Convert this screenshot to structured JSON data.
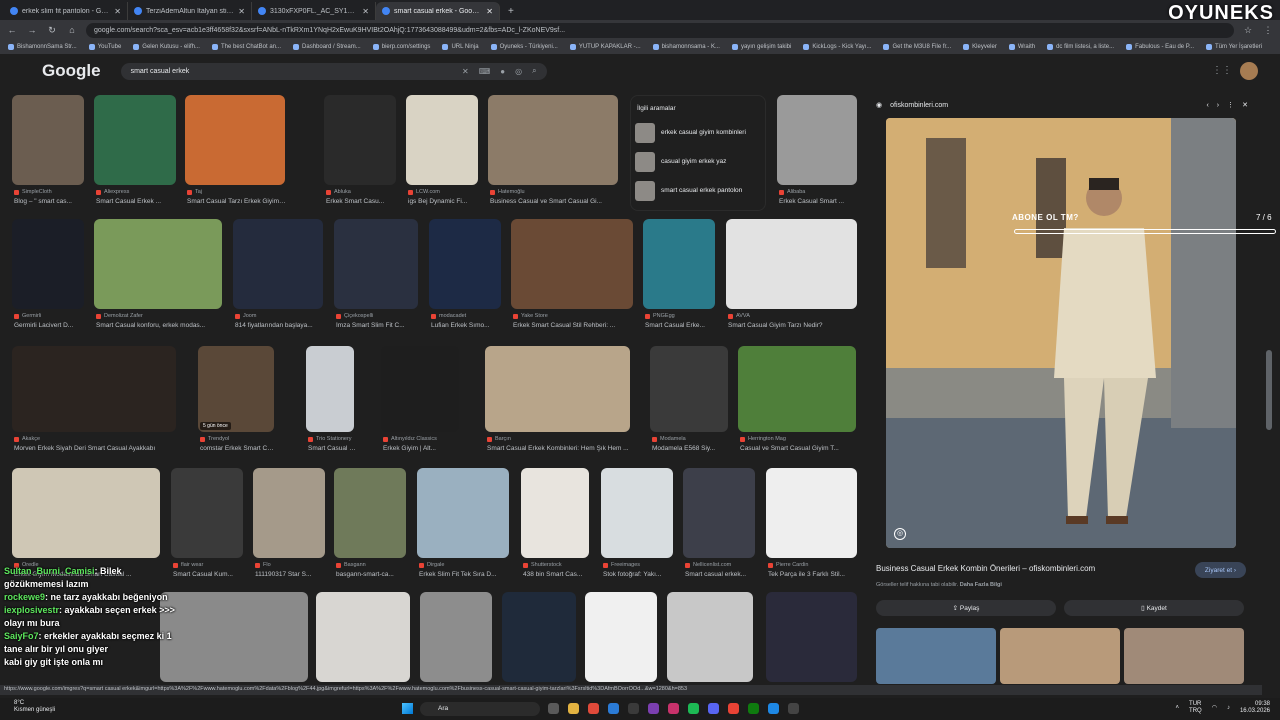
{
  "browser": {
    "tabs": [
      {
        "label": "erkek slim fit pantolon - Google'da A",
        "active": false
      },
      {
        "label": "TerziAdemAltun İtalyan stil slim fit er",
        "active": false
      },
      {
        "label": "3130xFXP0FL._AC_SY1000_.jpg (241×",
        "active": false
      },
      {
        "label": "smart casual erkek - Google'da Ara",
        "active": true
      }
    ],
    "new_tab": "+",
    "url": "google.com/search?sca_esv=acb1e3ff4658f32&sxsrf=ANbL-nTkRXm1YNqH2xEwuK9HVIBt2OAhjQ:1773643088499&udm=2&fbs=ADc_l-ZKoNEV9sf...",
    "bookmarks": [
      "BishamonnSama Str...",
      "YouTube",
      "Gelen Kutusu - elifh...",
      "The best ChatBot an...",
      "Dashboard / Stream...",
      "bierp.com/settings",
      "URL Ninja",
      "Oyuneks - Türkiyeni...",
      "YUTUP KAPAKLAR -...",
      "bishamonnsama - K...",
      "yayın gelişim takibi",
      "KickLogs - Kick Yayı...",
      "Get the M3U8 File fr...",
      "Kleyveler",
      "Wraith",
      "dc film listesi, a liste...",
      "Fabulous - Eau de P...",
      "Tüm Yer İşaretleri"
    ]
  },
  "brand_overlay": "OYUNEKS",
  "google": {
    "logo": "Google",
    "query": "smart casual erkek"
  },
  "related": {
    "header": "İlgili aramalar",
    "items": [
      "erkek casual giyim kombinleri",
      "casual giyim erkek yaz",
      "smart casual erkek pantolon"
    ]
  },
  "results": [
    {
      "src": "SimpleCloth",
      "title": "Blog – \" smart cas...",
      "color": "#6b5d50"
    },
    {
      "src": "Aliexpress",
      "title": "Smart Casual Erkek ...",
      "color": "#2f6b49"
    },
    {
      "src": "Taj",
      "title": "Smart Casual Tarzı Erkek Giyim Ko...",
      "color": "#c96a33"
    },
    {
      "src": "Abluka",
      "title": "Erkek Smart Casu...",
      "color": "#2a2a2a"
    },
    {
      "src": "LCW.com",
      "title": "igs Bej Dynamic Fi...",
      "color": "#d9d3c4"
    },
    {
      "src": "Hatemoğlu",
      "title": "Business Casual ve Smart Casual Gi...",
      "color": "#8c7b68"
    },
    {
      "src": "Alibaba",
      "title": "Erkek Casual Smart ...",
      "color": "#9a9a9a"
    },
    {
      "src": "Germirli",
      "title": "Germirli Lacivert D...",
      "color": "#1b1e27"
    },
    {
      "src": "Demolizat Zafer",
      "title": "Smart Casual konforu, erkek modas...",
      "color": "#7a9a5a"
    },
    {
      "src": "Joom",
      "title": "814 fiyatlarından başlaya...",
      "color": "#242b3d"
    },
    {
      "src": "Çiçekospelli",
      "title": "İmza Smart Slim Fit C...",
      "color": "#2a3040"
    },
    {
      "src": "modacadet",
      "title": "Lufian Erkek Sımo...",
      "color": "#1d2a45"
    },
    {
      "src": "Yake Store",
      "title": "Erkek Smart Casual Stil Rehberi: ...",
      "color": "#6a4a35"
    },
    {
      "src": "PNGEgg",
      "title": "Smart Casual Erke...",
      "color": "#2a7a8a"
    },
    {
      "src": "AVVA",
      "title": "Smart Casual Giyim Tarzı Nedir?",
      "color": "#e2e2e2"
    },
    {
      "src": "Akakçe",
      "title": "Morven Erkek Siyah Deri Smart Casual Ayakkabı",
      "color": "#2b2420"
    },
    {
      "src": "Trendyol",
      "title": "comstar Erkek Smart Ca...",
      "color": "#5a4838"
    },
    {
      "src": "Trio Stationery",
      "title": "Smart Casual Styl...",
      "color": "#c9cdd2"
    },
    {
      "src": "Altınyıldız Classics",
      "title": "Erkek Giyim | Alt...",
      "color": "#1e1e1e"
    },
    {
      "src": "Barçın",
      "title": "Smart Casual Erkek Kombinleri: Hem Şık Hem ...",
      "color": "#b8a58a"
    },
    {
      "src": "Modamela",
      "title": "Modamela E568 Siy...",
      "color": "#3a3a3a"
    },
    {
      "src": "Herrington Mag",
      "title": "Casual ve Smart Casual Giyim T...",
      "color": "#4f7f3a"
    },
    {
      "src": "Oredle",
      "title": "Erkek Giyim Modasında Smart Casual ...",
      "color": "#cfc7b5"
    },
    {
      "src": "flair wear",
      "title": "Smart Casual Kum...",
      "color": "#3a3a3a"
    },
    {
      "src": "Flo",
      "title": "111190317 Star S...",
      "color": "#a59a8a"
    },
    {
      "src": "Basgann",
      "title": "basgann-smart-ca...",
      "color": "#6f7a5a"
    },
    {
      "src": "Dirgale",
      "title": "Erkek Slim Fit Tek Sıra D...",
      "color": "#9ab0c0"
    },
    {
      "src": "Shutterstock",
      "title": "438 bin Smart Cas...",
      "color": "#e8e4de"
    },
    {
      "src": "Freeimages",
      "title": "Stok fotoğraf: Yakı...",
      "color": "#d8dde0"
    },
    {
      "src": "Nellicenlist.com",
      "title": "Smart casual erkek...",
      "color": "#3d3f4a"
    },
    {
      "src": "Pierre Cardin",
      "title": "Tek Parça ile 3 Farklı Stil...",
      "color": "#eeeeee"
    }
  ],
  "row5_colors": [
    "#8a8a8a",
    "#d8d6d2",
    "#8d8d8d",
    "#1f2a3a",
    "#f0f0f0",
    "#c8c8c8",
    "#2a2a3a"
  ],
  "thumb_badge": "5 gün önce",
  "panel": {
    "source": "ofiskombinleri.com",
    "title": "Business Casual Erkek Kombin Önerileri – ofiskombinleri.com",
    "subtitle": "Görseller telif hakkına tabi olabilir.",
    "subtitle_link": "Daha Fazla Bilgi",
    "visit": "Ziyaret et",
    "share": "Paylaş",
    "save": "Kaydet",
    "thumb_colors": [
      "#5a7a9a",
      "#b89a7a",
      "#a08a78"
    ]
  },
  "subscribe_overlay": {
    "text": "ABONE OL TM?",
    "count": "7 / 6"
  },
  "chat": [
    {
      "name": "Sultan_Burni_Camisi",
      "msg": ": Bilek"
    },
    {
      "name": "",
      "msg": "gözükmemesi lazım"
    },
    {
      "name": "rockewe9",
      "msg": ": ne tarz ayakkabı beğeniyon"
    },
    {
      "name": "iexplosivestr",
      "msg": ": ayakkabı seçen erkek >>>"
    },
    {
      "name": "",
      "msg": "olayı mı bura"
    },
    {
      "name": "SaiyFo7",
      "msg": ": erkekler ayakkabı seçmez ki 1"
    },
    {
      "name": "",
      "msg": "tane alır bir yıl onu giyer"
    },
    {
      "name": "",
      "msg": "kabi giy git işte onla mı"
    }
  ],
  "status_url": "https://www.google.com/imgres?q=smart casual erkek&imgurl=https%3A%2F%2Fwww.hatemoglu.com%2Fdata%2Fblog%2F44.jpg&imgrefurl=https%3A%2F%2Fwww.hatemoglu.com%2Fbusiness-casual-smart-casual-giyim-tarzlari%3Fsrsltid%3DAfmBOorrOOd...&w=1280&h=853",
  "taskbar": {
    "temp": "8°C",
    "weather": "Kısmen güneşli",
    "search": "Ara",
    "lang": "TUR",
    "lang2": "TRQ",
    "time": "09:38",
    "date": "16.03.2026"
  }
}
